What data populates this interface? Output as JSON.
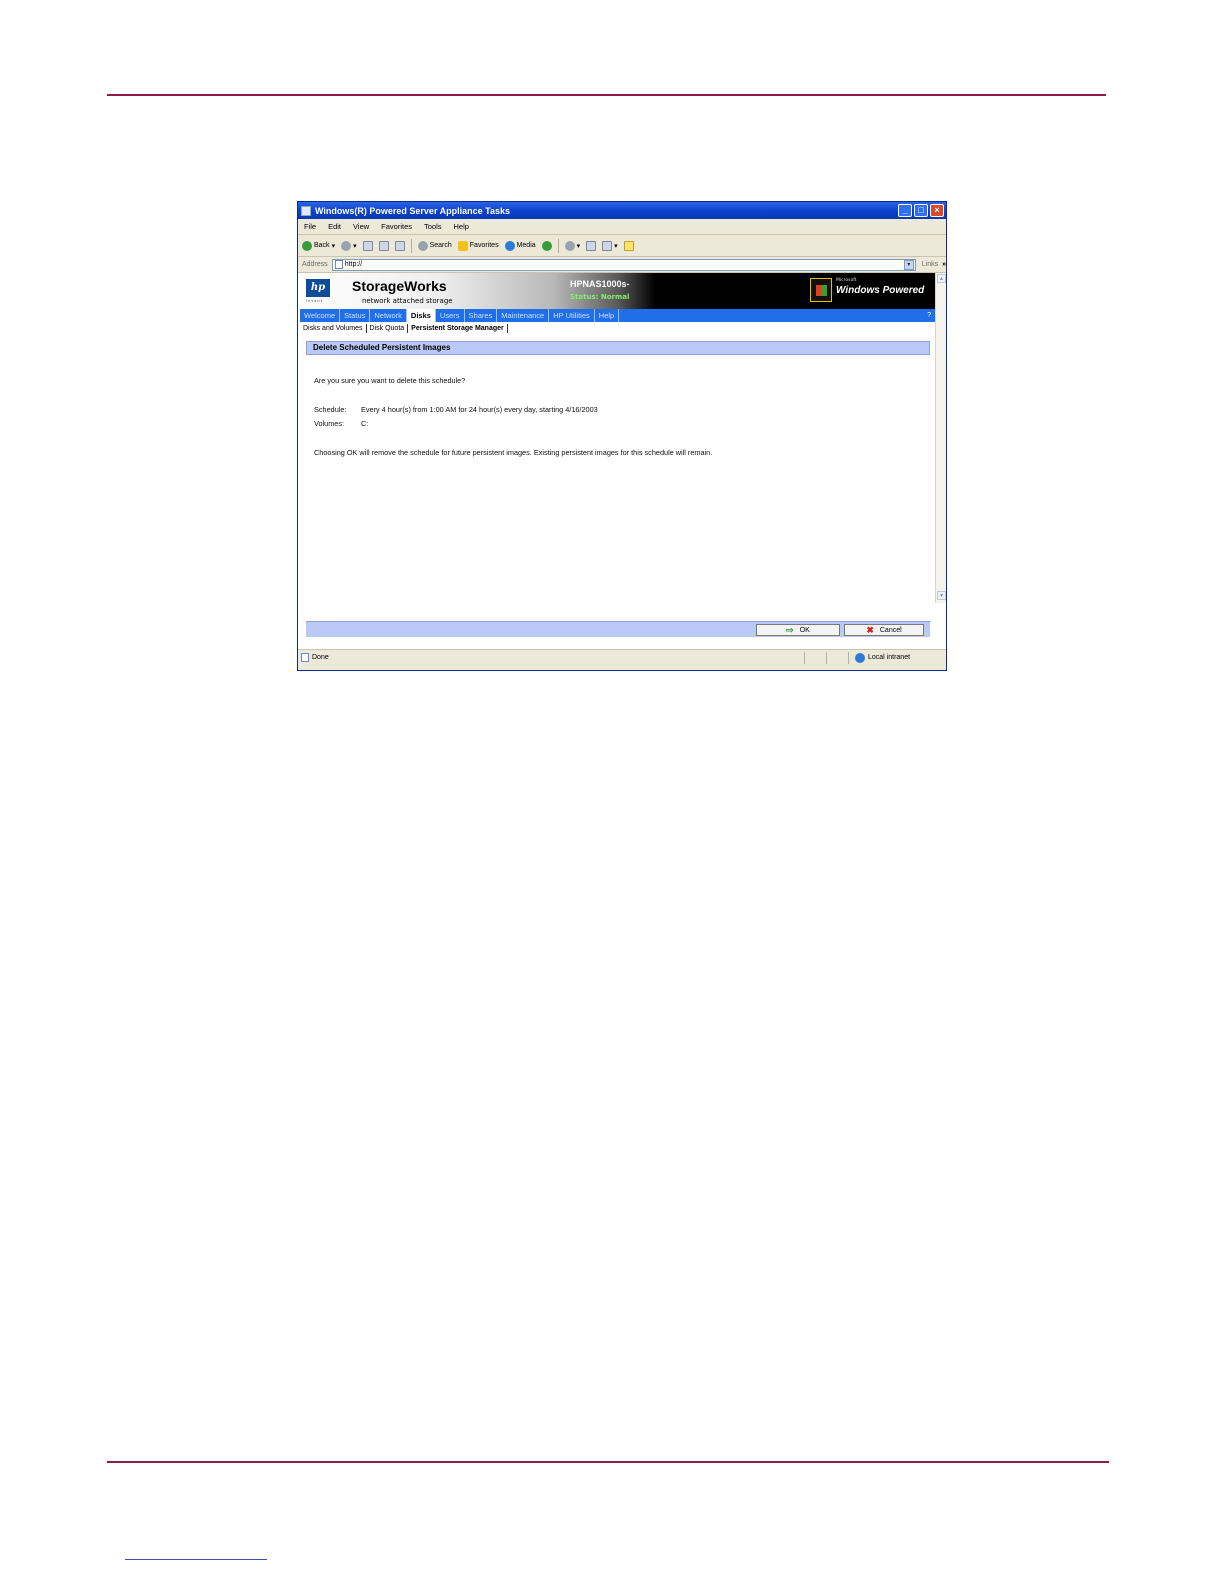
{
  "window": {
    "title": "Windows(R) Powered Server Appliance Tasks"
  },
  "menu": [
    "File",
    "Edit",
    "View",
    "Favorites",
    "Tools",
    "Help"
  ],
  "toolbar": {
    "back": "Back",
    "search": "Search",
    "favorites": "Favorites",
    "media": "Media"
  },
  "address": {
    "label": "Address",
    "url": "http://",
    "links": "Links"
  },
  "banner": {
    "hp_tag": "invent",
    "brand": "StorageWorks",
    "brand_sub": "network attached storage",
    "device_name": "HPNAS1000s-",
    "device_status": "Status: Normal",
    "ms_small": "Microsoft",
    "windows_powered": "Windows Powered"
  },
  "tabs": [
    {
      "label": "Welcome",
      "active": false
    },
    {
      "label": "Status",
      "active": false
    },
    {
      "label": "Network",
      "active": false
    },
    {
      "label": "Disks",
      "active": true
    },
    {
      "label": "Users",
      "active": false
    },
    {
      "label": "Shares",
      "active": false
    },
    {
      "label": "Maintenance",
      "active": false
    },
    {
      "label": "HP Utilities",
      "active": false
    },
    {
      "label": "Help",
      "active": false
    }
  ],
  "tab_help": "?",
  "subtabs": [
    {
      "label": "Disks and Volumes",
      "active": false
    },
    {
      "label": "Disk Quota",
      "active": false
    },
    {
      "label": "Persistent Storage Manager",
      "active": true
    }
  ],
  "page": {
    "heading": "Delete Scheduled Persistent Images",
    "question": "Are you sure you want to delete this schedule?",
    "schedule_label": "Schedule:",
    "schedule_value": "Every 4 hour(s) from 1:00 AM for 24 hour(s) every day, starting 4/16/2003",
    "volumes_label": "Volumes:",
    "volumes_value": "C:",
    "note": "Choosing OK will remove the schedule for future persistent images. Existing persistent images for this schedule will remain."
  },
  "buttons": {
    "ok": "OK",
    "cancel": "Cancel"
  },
  "status": {
    "left": "Done",
    "zone": "Local intranet"
  }
}
